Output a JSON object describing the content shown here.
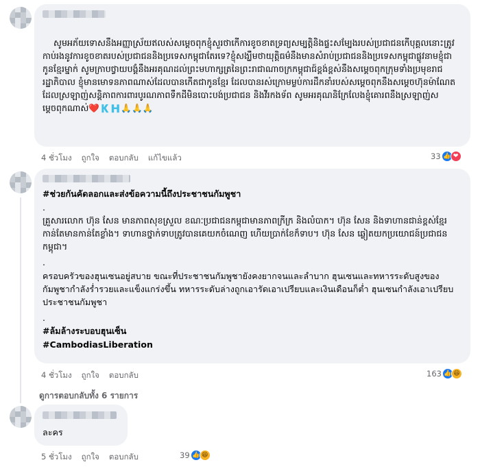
{
  "comment1": {
    "text": "សូមអភ័យទោសនឹងអញ្ញាស្រ័យឥលស់សម្តេចពុកខ្ញុំសួរថាកើការខូចខាតទ្រព្យសម្បត្តិនិងផ្ទះសម្បែងរបស់ប្រជាជនកើបុគ្គលនោះត្រូវកាប់រងនូវការខូចខាតរបស់ប្រជាជននិងប្រទេសកម្ពុជាតែរទេ?ខ្ញុំសង្ឃឹមថាយុត្តិធម៌នឹងមានសំរាប់ប្រជាជននិងប្រទេសកម្ពុជាផ្លូវនាមខ្ញុំជាកូនខ្មែរម្នាក់ សូមក្រាបថ្វាយបង្គំនឹងអរគុណដល់ព្រះមហាក្សត្រនៃព្រះរាជាណាចក្រកម្ពុជាជ៍ខ្ពង់ខ្ពស់នឹងសម្តេចពុកក្រុមទាំងប្រមុខរាជរដ្ឋាភិបាល ខ្ញុំមានមោទនភាពណាស់ដែលបានកើតជាកូនខ្មែរ ដែលបានរស់ក្រោមម្លប់ការដឹកនាំរបស់សម្តេចពុកនឹងសម្តេចហ៊ុនម៉ាណែតដែលស្រឡាញ់សន្តិភាពការពារបូរណភាពទឹកដីមិនបោះបង់ប្រជាជន និងវីរកងទ័ព សូមអរគុណនិក្រែលែងខ្ញុំគោរពនឹងស្រឡាញ់សម្តេចពុកណាស់",
    "emoji_tail": "❤️🇰🇭🙏🙏🙏",
    "time": "4 ชั่วโมง",
    "like": "ถูกใจ",
    "reply": "ตอบกลับ",
    "edited": "แก้ไขแล้ว",
    "reaction_count": "33"
  },
  "comment2": {
    "hashtag_title": "#ช่วยกันคัดลอกและส่งข้อความนี้ถึงประชาชนกัมพูชา",
    "dot1": ".",
    "khmer_paragraph": "គ្រួសារលោក ហ៊ុន សែន មានភាពសុខស្រួល ខណៈប្រជាជនកម្ពុជាមានភាពក្រីក្រ និងលំបាក។ ហ៊ុន សែន និងទាហានជាន់ខ្ពស់ខ្មែរកាន់តែមានកាន់តែខ្លាំង។ ទាហានថ្នាក់ទាបត្រូវបានគេយកចំណេញ ហើយប្រាក់ខែក៏ទាប។ ហ៊ុន សែន ឆ្លៀតយកប្រយោជន៍ប្រជាជនកម្ពុជា។",
    "dot2": ".",
    "thai_paragraph": "ครอบครัวของฮุนเซนอยู่สบาย ขณะที่ประชาชนกัมพูชายังคงยากจนและลำบาก ฮุนเซนและทหารระดับสูงของกัมพูชากำลังร่ำรวยและแข็งแกร่งขึ้น ทหารระดับล่างถูกเอารัดเอาเปรียบและเงินเดือนก็ต่ำ ฮุนเซนกำลังเอาเปรียบประชาชนกัมพูชา",
    "dot3": ".",
    "hashtag2": "#ล้มล้างระบอบฮุนเซ็น",
    "hashtag3": "#CambodiasLiberation",
    "time": "4 ชั่วโมง",
    "like": "ถูกใจ",
    "reply": "ตอบกลับ",
    "reaction_count": "163"
  },
  "view_replies": "ดูการตอบกลับทั้ง 6 รายการ",
  "comment3": {
    "text": "ละคร",
    "time": "5 ชั่วโมง",
    "like": "ถูกใจ",
    "reply": "ตอบกลับ",
    "reaction_count": "39"
  },
  "colors": {
    "like": "#1877f2",
    "love": "#f33e58",
    "haha": "#f7b125",
    "bubble": "#f0f2f5"
  }
}
